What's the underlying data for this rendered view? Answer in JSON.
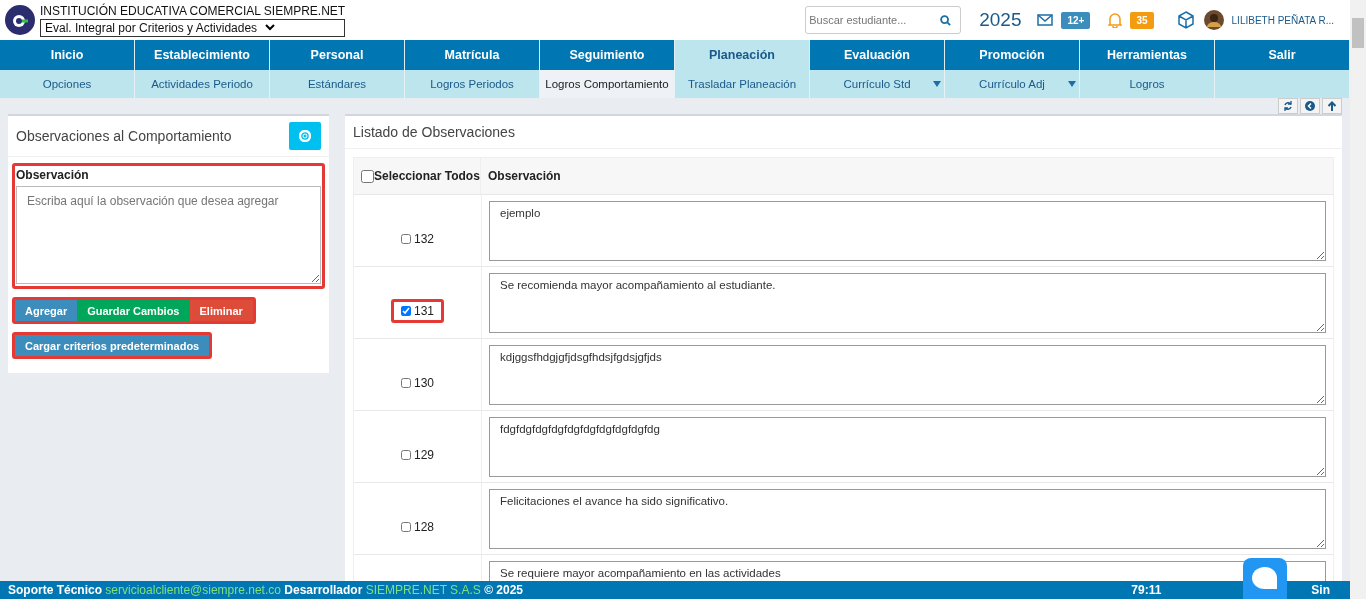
{
  "header": {
    "institution": "INSTITUCIÓN EDUCATIVA COMERCIAL SIEMPRE.NET",
    "mode_select": "Eval. Integral por Criterios y Actividades",
    "search": {
      "placeholder": "Buscar estudiante..."
    },
    "year": "2025",
    "messages_badge": "12+",
    "notifications_badge": "35",
    "user": "LILIBETH PEÑATA R..."
  },
  "menu": [
    {
      "label": "Inicio",
      "selected": false
    },
    {
      "label": "Establecimiento",
      "selected": false
    },
    {
      "label": "Personal",
      "selected": false
    },
    {
      "label": "Matrícula",
      "selected": false
    },
    {
      "label": "Seguimiento",
      "selected": false
    },
    {
      "label": "Planeación",
      "selected": true
    },
    {
      "label": "Evaluación",
      "selected": false
    },
    {
      "label": "Promoción",
      "selected": false
    },
    {
      "label": "Herramientas",
      "selected": false
    },
    {
      "label": "Salir",
      "selected": false
    }
  ],
  "submenu": [
    {
      "label": "Opciones",
      "selected": false,
      "dropdown": false
    },
    {
      "label": "Actividades Periodo",
      "selected": false,
      "dropdown": false
    },
    {
      "label": "Estándares",
      "selected": false,
      "dropdown": false
    },
    {
      "label": "Logros Periodos",
      "selected": false,
      "dropdown": false
    },
    {
      "label": "Logros Comportamiento",
      "selected": true,
      "dropdown": false
    },
    {
      "label": "Trasladar Planeación",
      "selected": false,
      "dropdown": false
    },
    {
      "label": "Currículo Std",
      "selected": false,
      "dropdown": true
    },
    {
      "label": "Currículo Adj",
      "selected": false,
      "dropdown": true
    },
    {
      "label": "Logros",
      "selected": false,
      "dropdown": false
    }
  ],
  "form_panel": {
    "title": "Observaciones al Comportamiento",
    "field_label": "Observación",
    "field": {
      "placeholder": "Escriba aquí la observación que desea agregar"
    },
    "buttons": [
      {
        "label": "Agregar",
        "kind": "primary"
      },
      {
        "label": "Guardar Cambios",
        "kind": "success"
      },
      {
        "label": "Eliminar",
        "kind": "danger"
      }
    ],
    "load_button": "Cargar criterios predeterminados"
  },
  "list_panel": {
    "title": "Listado de Observaciones",
    "columns": [
      "Seleccionar Todos",
      "Observación"
    ],
    "select_all_checked": false,
    "rows": [
      {
        "id": "132",
        "checked": false,
        "highlighted": false,
        "text": "ejemplo"
      },
      {
        "id": "131",
        "checked": true,
        "highlighted": true,
        "text": "Se recomienda mayor acompañamiento al estudiante."
      },
      {
        "id": "130",
        "checked": false,
        "highlighted": false,
        "text": "kdjggsfhdgjgfjdsgfhdsjfgdsjgfjds"
      },
      {
        "id": "129",
        "checked": false,
        "highlighted": false,
        "text": "fdgfdgfdgfdgfdgfdgfdgfdgfdgfdg"
      },
      {
        "id": "128",
        "checked": false,
        "highlighted": false,
        "text": "Felicitaciones el avance ha sido significativo."
      },
      {
        "text": "Se requiere mayor acompañamiento en las actividades"
      }
    ]
  },
  "footer": {
    "support_label": "Soporte Técnico",
    "support_email": "servicioalcliente@siempre.net.co",
    "dev_label": "Desarrollador",
    "dev_name": "SIEMPRE.NET S.A.S",
    "copyright": "© 2025",
    "time": "79:11",
    "brand": "Sin"
  }
}
